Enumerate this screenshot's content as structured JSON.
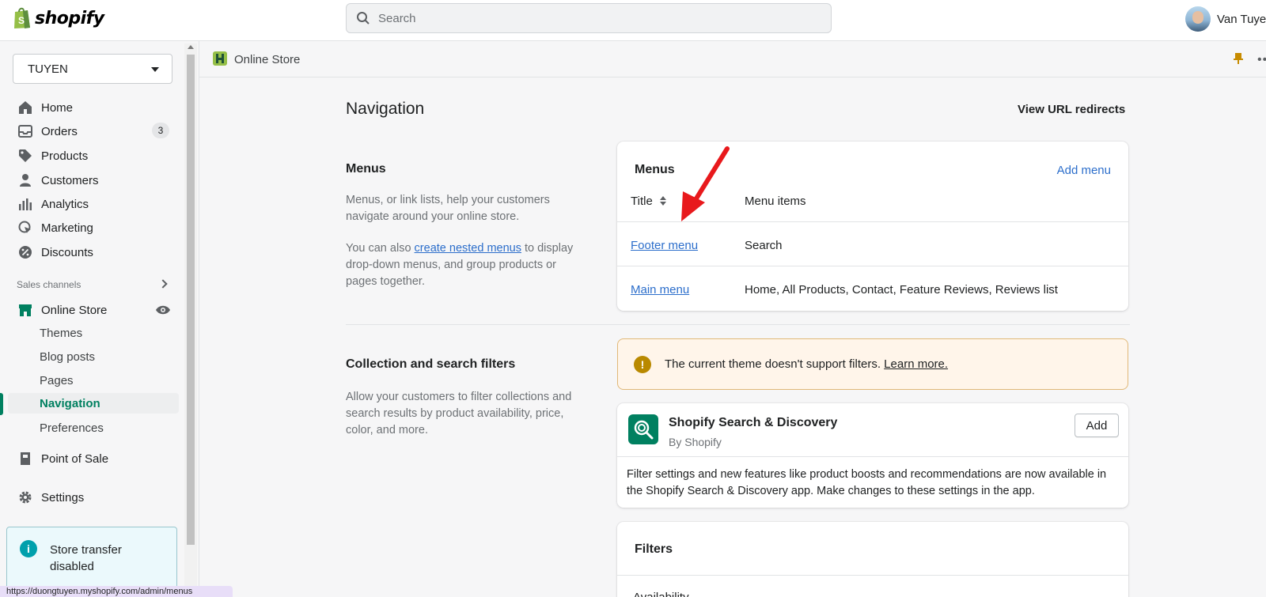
{
  "topbar": {
    "logo_text": "shopify",
    "search_placeholder": "Search",
    "user_name": "Van Tuye"
  },
  "sidebar": {
    "store_name": "TUYEN",
    "items": [
      {
        "label": "Home",
        "icon": "home-icon"
      },
      {
        "label": "Orders",
        "icon": "orders-icon",
        "badge": "3"
      },
      {
        "label": "Products",
        "icon": "tag-icon"
      },
      {
        "label": "Customers",
        "icon": "person-icon"
      },
      {
        "label": "Analytics",
        "icon": "bar-chart-icon"
      },
      {
        "label": "Marketing",
        "icon": "target-icon"
      },
      {
        "label": "Discounts",
        "icon": "discount-icon"
      }
    ],
    "sales_channels_label": "Sales channels",
    "online_store": {
      "label": "Online Store",
      "sub_items": [
        "Themes",
        "Blog posts",
        "Pages",
        "Navigation",
        "Preferences"
      ],
      "active": "Navigation"
    },
    "point_of_sale": "Point of Sale",
    "settings": "Settings",
    "transfer_notice": "Store transfer disabled",
    "status_url": "https://duongtuyen.myshopify.com/admin/menus"
  },
  "subheader": {
    "title": "Online Store"
  },
  "page": {
    "title": "Navigation",
    "redirects_link": "View URL redirects"
  },
  "menus_section": {
    "heading": "Menus",
    "desc1": "Menus, or link lists, help your customers navigate around your online store.",
    "desc2_before": "You can also ",
    "desc2_link": "create nested menus",
    "desc2_after": " to display drop-down menus, and group products or pages together.",
    "card_title": "Menus",
    "add_menu": "Add menu",
    "col_title": "Title",
    "col_items": "Menu items",
    "rows": [
      {
        "title": "Footer menu",
        "items": "Search"
      },
      {
        "title": "Main menu",
        "items": "Home, All Products, Contact, Feature Reviews, Reviews list"
      }
    ]
  },
  "filters_section": {
    "heading": "Collection and search filters",
    "desc": "Allow your customers to filter collections and search results by product availability, price, color, and more.",
    "warning_text": "The current theme doesn't support filters. ",
    "warning_link": "Learn more.",
    "app_name": "Shopify Search & Discovery",
    "app_by": "By Shopify",
    "app_add": "Add",
    "app_desc": "Filter settings and new features like product boosts and recommendations are now available in the Shopify Search & Discovery app. Make changes to these settings in the app.",
    "filters_title": "Filters",
    "availability_label": "Availability"
  },
  "colors": {
    "accent_green": "#008060",
    "link_blue": "#2c6ecb",
    "annotation_red": "#e8191c"
  }
}
